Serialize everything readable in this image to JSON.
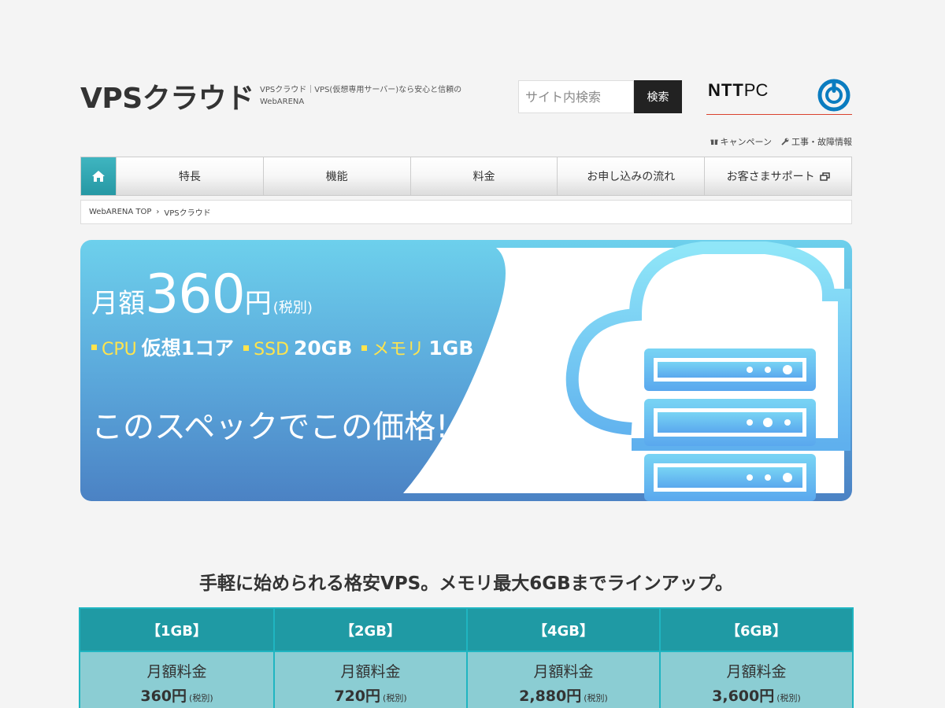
{
  "header": {
    "site_title": "VPSクラウド",
    "description": "VPSクラウド｜VPS(仮想専用サーバー)なら安心と信頼のWebARENA",
    "search": {
      "placeholder": "サイト内検索",
      "button": "検索"
    },
    "brand": {
      "ntt": "NTT",
      "pc": "PC",
      "logo_color": "#0a7cc0"
    }
  },
  "util_links": [
    {
      "icon": "gift-icon",
      "label": "キャンペーン"
    },
    {
      "icon": "wrench-icon",
      "label": "工事・故障情報"
    }
  ],
  "nav": {
    "home_icon": "home-icon",
    "items": [
      {
        "label": "特長"
      },
      {
        "label": "機能"
      },
      {
        "label": "料金"
      },
      {
        "label": "お申し込みの流れ"
      },
      {
        "label": "お客さまサポート",
        "icon": "external-window-icon"
      }
    ]
  },
  "breadcrumb": {
    "items": [
      "WebARENA TOP",
      "VPSクラウド"
    ],
    "separator": "›"
  },
  "hero": {
    "price_label": "月額",
    "price": "360",
    "price_unit": "円",
    "tax": "(税別)",
    "specs": [
      {
        "key": "CPU",
        "value": "仮想1コア"
      },
      {
        "key": "SSD",
        "value": "20GB"
      },
      {
        "key": "メモリ",
        "value": "1GB"
      }
    ],
    "catch": "このスペックでこの価格!",
    "colors": {
      "accent": "#ffe44d",
      "sky_top": "#6dd0ec",
      "sky_bottom": "#4b82c4"
    }
  },
  "section": {
    "title": "手軽に始められる格安VPS。メモリ最大6GBまでラインアップ。"
  },
  "plans": [
    {
      "name": "【1GB】",
      "fee_label": "月額料金",
      "price": "360円",
      "tax": "(税別)"
    },
    {
      "name": "【2GB】",
      "fee_label": "月額料金",
      "price": "720円",
      "tax": "(税別)"
    },
    {
      "name": "【4GB】",
      "fee_label": "月額料金",
      "price": "2,880円",
      "tax": "(税別)"
    },
    {
      "name": "【6GB】",
      "fee_label": "月額料金",
      "price": "3,600円",
      "tax": "(税別)"
    }
  ]
}
